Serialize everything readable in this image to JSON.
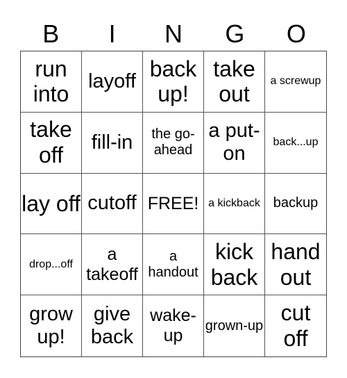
{
  "header": {
    "letters": [
      "B",
      "I",
      "N",
      "G",
      "O"
    ]
  },
  "cells": [
    {
      "text": "run into",
      "size": "xl"
    },
    {
      "text": "layoff",
      "size": "l"
    },
    {
      "text": "back up!",
      "size": "xl"
    },
    {
      "text": "take out",
      "size": "xl"
    },
    {
      "text": "a screwup",
      "size": "xs"
    },
    {
      "text": "take off",
      "size": "xl"
    },
    {
      "text": "fill-in",
      "size": "l"
    },
    {
      "text": "the go-ahead",
      "size": "s"
    },
    {
      "text": "a put-on",
      "size": "l"
    },
    {
      "text": "back...up",
      "size": "xs"
    },
    {
      "text": "lay off",
      "size": "xl"
    },
    {
      "text": "cutoff",
      "size": "l"
    },
    {
      "text": "FREE!",
      "size": "m"
    },
    {
      "text": "a kickback",
      "size": "xs"
    },
    {
      "text": "backup",
      "size": "s"
    },
    {
      "text": "drop...off",
      "size": "xs"
    },
    {
      "text": "a takeoff",
      "size": "m"
    },
    {
      "text": "a handout",
      "size": "s"
    },
    {
      "text": "kick back",
      "size": "xl"
    },
    {
      "text": "hand out",
      "size": "xl"
    },
    {
      "text": "grow up!",
      "size": "l"
    },
    {
      "text": "give back",
      "size": "l"
    },
    {
      "text": "wake-up",
      "size": "m"
    },
    {
      "text": "grown-up",
      "size": "s"
    },
    {
      "text": "cut off",
      "size": "xl"
    }
  ]
}
